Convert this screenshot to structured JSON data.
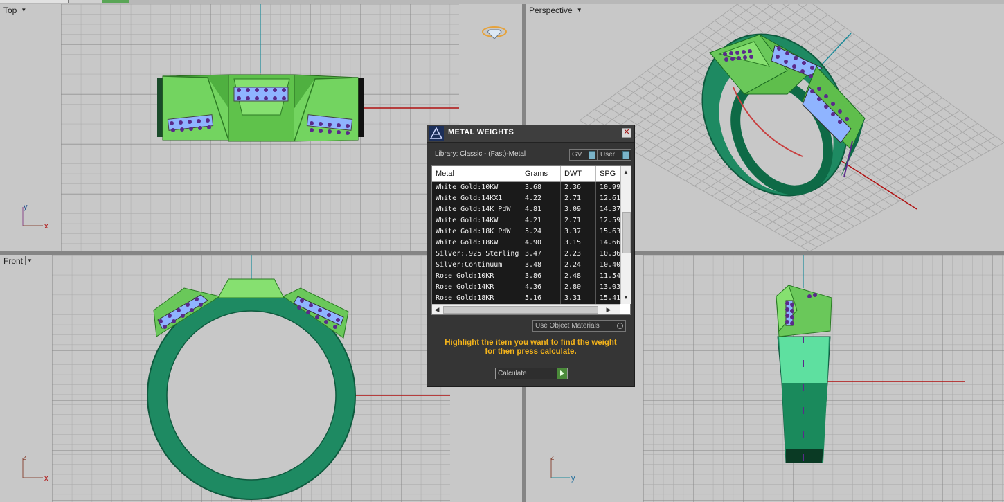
{
  "viewports": {
    "top": {
      "label": "Top",
      "axis_a": "y",
      "axis_b": "x"
    },
    "perspective": {
      "label": "Perspective"
    },
    "front": {
      "label": "Front",
      "axis_a": "z",
      "axis_b": "x"
    },
    "right": {
      "axis_a": "z",
      "axis_b": "y"
    }
  },
  "dialog": {
    "title": "METAL WEIGHTS",
    "close_glyph": "✕",
    "library_label": "Library: Classic - (Fast)-Metal",
    "gv_label": "GV",
    "user_label": "User",
    "columns": [
      "Metal",
      "Grams",
      "DWT",
      "SPG"
    ],
    "rows": [
      {
        "metal": "White Gold:10KW",
        "grams": "3.68",
        "dwt": "2.36",
        "spg": "10.99"
      },
      {
        "metal": "White Gold:14KX1",
        "grams": "4.22",
        "dwt": "2.71",
        "spg": "12.61"
      },
      {
        "metal": "White Gold:14K PdW",
        "grams": "4.81",
        "dwt": "3.09",
        "spg": "14.37"
      },
      {
        "metal": "White Gold:14KW",
        "grams": "4.21",
        "dwt": "2.71",
        "spg": "12.59"
      },
      {
        "metal": "White Gold:18K PdW",
        "grams": "5.24",
        "dwt": "3.37",
        "spg": "15.63"
      },
      {
        "metal": "White Gold:18KW",
        "grams": "4.90",
        "dwt": "3.15",
        "spg": "14.66"
      },
      {
        "metal": "Silver:.925 Sterling",
        "grams": "3.47",
        "dwt": "2.23",
        "spg": "10.36"
      },
      {
        "metal": "Silver:Continuum",
        "grams": "3.48",
        "dwt": "2.24",
        "spg": "10.40"
      },
      {
        "metal": "Rose Gold:10KR",
        "grams": "3.86",
        "dwt": "2.48",
        "spg": "11.54"
      },
      {
        "metal": "Rose Gold:14KR",
        "grams": "4.36",
        "dwt": "2.80",
        "spg": "13.03"
      },
      {
        "metal": "Rose Gold:18KR",
        "grams": "5.16",
        "dwt": "3.31",
        "spg": "15.41"
      }
    ],
    "use_object_materials_label": "Use Object Materials",
    "hint_line1": "Highlight the item you want to find the weight",
    "hint_line2": "for then press calculate.",
    "calculate_label": "Calculate"
  },
  "colors": {
    "viewport_bg": "#c8c8c8",
    "ring_green": "#1e8a62",
    "top_face_green": "#7fd66a",
    "x_axis": "#b01010",
    "y_axis": "#1a8a9a",
    "gem_blue": "#8fb4ff",
    "gem_purple": "#5a2a8a",
    "hint_text": "#f2b21b",
    "dialog_bg": "#353535"
  }
}
